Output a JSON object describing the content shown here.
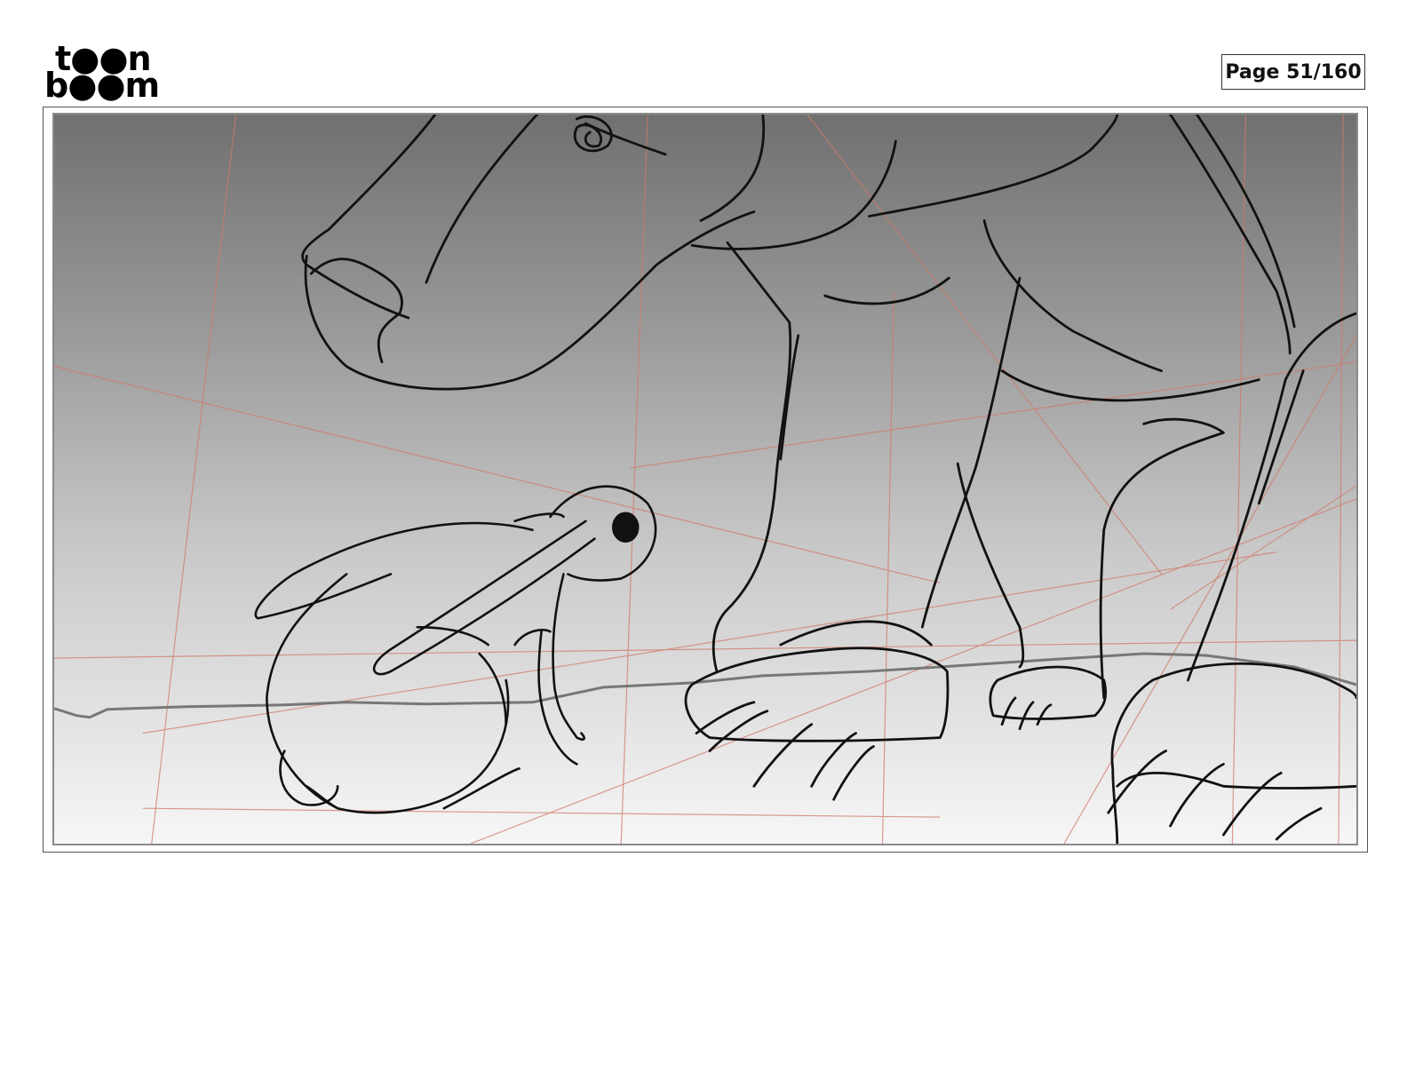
{
  "logo": {
    "line1": "t●●n",
    "line2": "b●●m",
    "icon": "toon-boom-logo-icon"
  },
  "page": {
    "label": "Page 51/160"
  },
  "panel": {
    "icon": "storyboard-sketch-icon"
  }
}
